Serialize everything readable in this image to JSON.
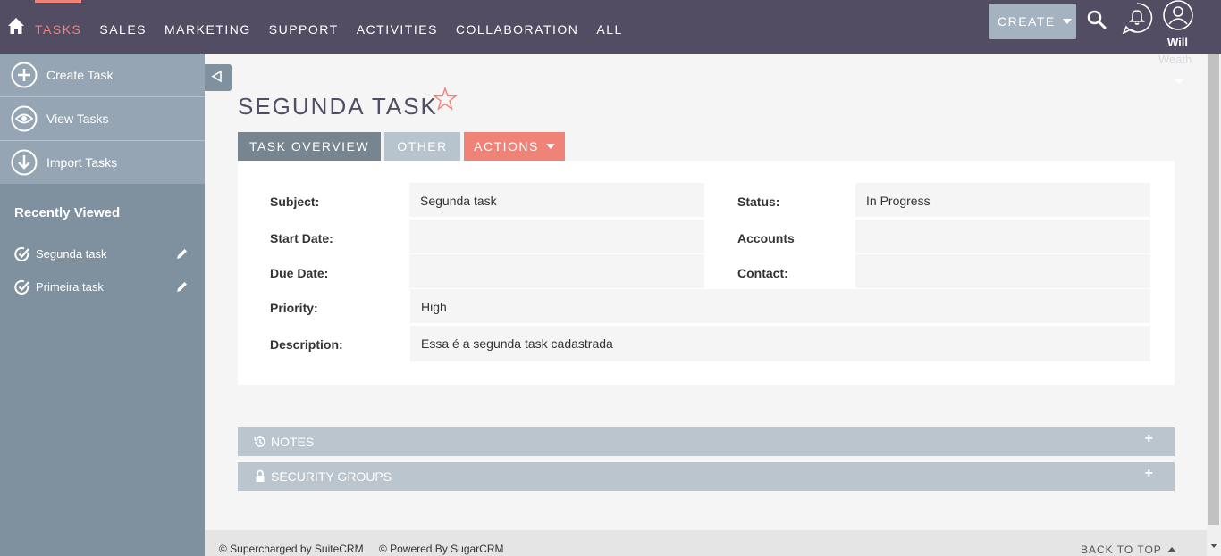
{
  "nav": {
    "items": [
      {
        "label": "TASKS",
        "active": true
      },
      {
        "label": "SALES"
      },
      {
        "label": "MARKETING"
      },
      {
        "label": "SUPPORT"
      },
      {
        "label": "ACTIVITIES"
      },
      {
        "label": "COLLABORATION"
      },
      {
        "label": "ALL"
      }
    ],
    "create_label": "CREATE",
    "user_name": "Will",
    "user_name_2": "Weath"
  },
  "sidebar": {
    "actions": [
      {
        "label": "Create Task",
        "icon": "plus-circle-icon"
      },
      {
        "label": "View Tasks",
        "icon": "eye-icon"
      },
      {
        "label": "Import Tasks",
        "icon": "download-icon"
      }
    ],
    "recent_title": "Recently Viewed",
    "recent": [
      {
        "label": "Segunda task"
      },
      {
        "label": "Primeira task"
      }
    ]
  },
  "record": {
    "title": "SEGUNDA TASK",
    "tabs": {
      "overview": "TASK OVERVIEW",
      "other": "OTHER",
      "actions": "ACTIONS"
    },
    "fields": {
      "subject_label": "Subject:",
      "subject_value": "Segunda task",
      "status_label": "Status:",
      "status_value": "In Progress",
      "start_label": "Start Date:",
      "start_value": "",
      "accounts_label": "Accounts",
      "accounts_value": "",
      "due_label": "Due Date:",
      "due_value": "",
      "contact_label": "Contact:",
      "contact_value": "",
      "priority_label": "Priority:",
      "priority_value": "High",
      "description_label": "Description:",
      "description_value": "Essa é a segunda task cadastrada"
    }
  },
  "subpanels": {
    "notes": "NOTES",
    "security": "SECURITY GROUPS",
    "expand": "+"
  },
  "footer": {
    "suite": "© Supercharged by SuiteCRM",
    "sugar": "© Powered By SugarCRM",
    "back_top": "BACK TO TOP"
  },
  "colors": {
    "nav_bg": "#534d64",
    "accent": "#f08377",
    "sidebar_bg": "#7f909f"
  }
}
